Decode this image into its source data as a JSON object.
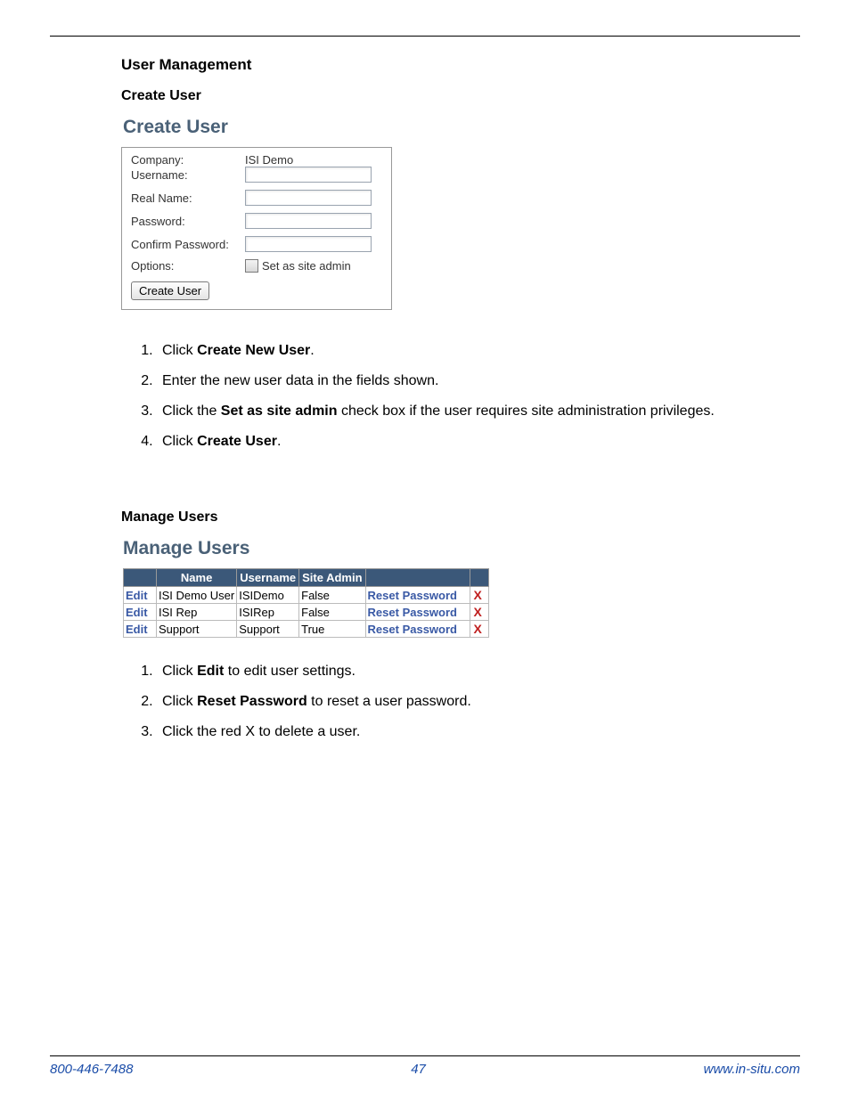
{
  "headings": {
    "user_management": "User Management",
    "create_user_sub": "Create User",
    "create_user_panel": "Create User",
    "manage_users_sub": "Manage Users",
    "manage_users_panel": "Manage Users"
  },
  "create_form": {
    "labels": {
      "company": "Company:",
      "username": "Username:",
      "real_name": "Real Name:",
      "password": "Password:",
      "confirm_password": "Confirm Password:",
      "options": "Options:"
    },
    "company_value": "ISI Demo",
    "site_admin_label": "Set as site admin",
    "button": "Create User"
  },
  "create_steps": {
    "s1_prefix": "Click ",
    "s1_bold": "Create New User",
    "s1_suffix": ".",
    "s2": "Enter the new user data in the fields shown.",
    "s3_prefix": "Click the ",
    "s3_bold": "Set as site admin",
    "s3_suffix": " check box if the user requires site administration privileges.",
    "s4_prefix": "Click ",
    "s4_bold": "Create User",
    "s4_suffix": "."
  },
  "users_table": {
    "headers": {
      "name": "Name",
      "username": "Username",
      "site_admin": "Site Admin"
    },
    "labels": {
      "edit": "Edit",
      "reset_password": "Reset Password",
      "delete_icon": "X"
    },
    "rows": [
      {
        "name": "ISI Demo User",
        "username": "ISIDemo",
        "site_admin": "False"
      },
      {
        "name": "ISI Rep",
        "username": "ISIRep",
        "site_admin": "False"
      },
      {
        "name": "Support",
        "username": "Support",
        "site_admin": "True"
      }
    ]
  },
  "manage_steps": {
    "s1_prefix": "Click ",
    "s1_bold": "Edit",
    "s1_suffix": " to edit user settings.",
    "s2_prefix": "Click ",
    "s2_bold": "Reset Password",
    "s2_suffix": " to reset a user password.",
    "s3": "Click the red X to delete a user."
  },
  "footer": {
    "phone": "800-446-7488",
    "page": "47",
    "url": "www.in-situ.com"
  }
}
